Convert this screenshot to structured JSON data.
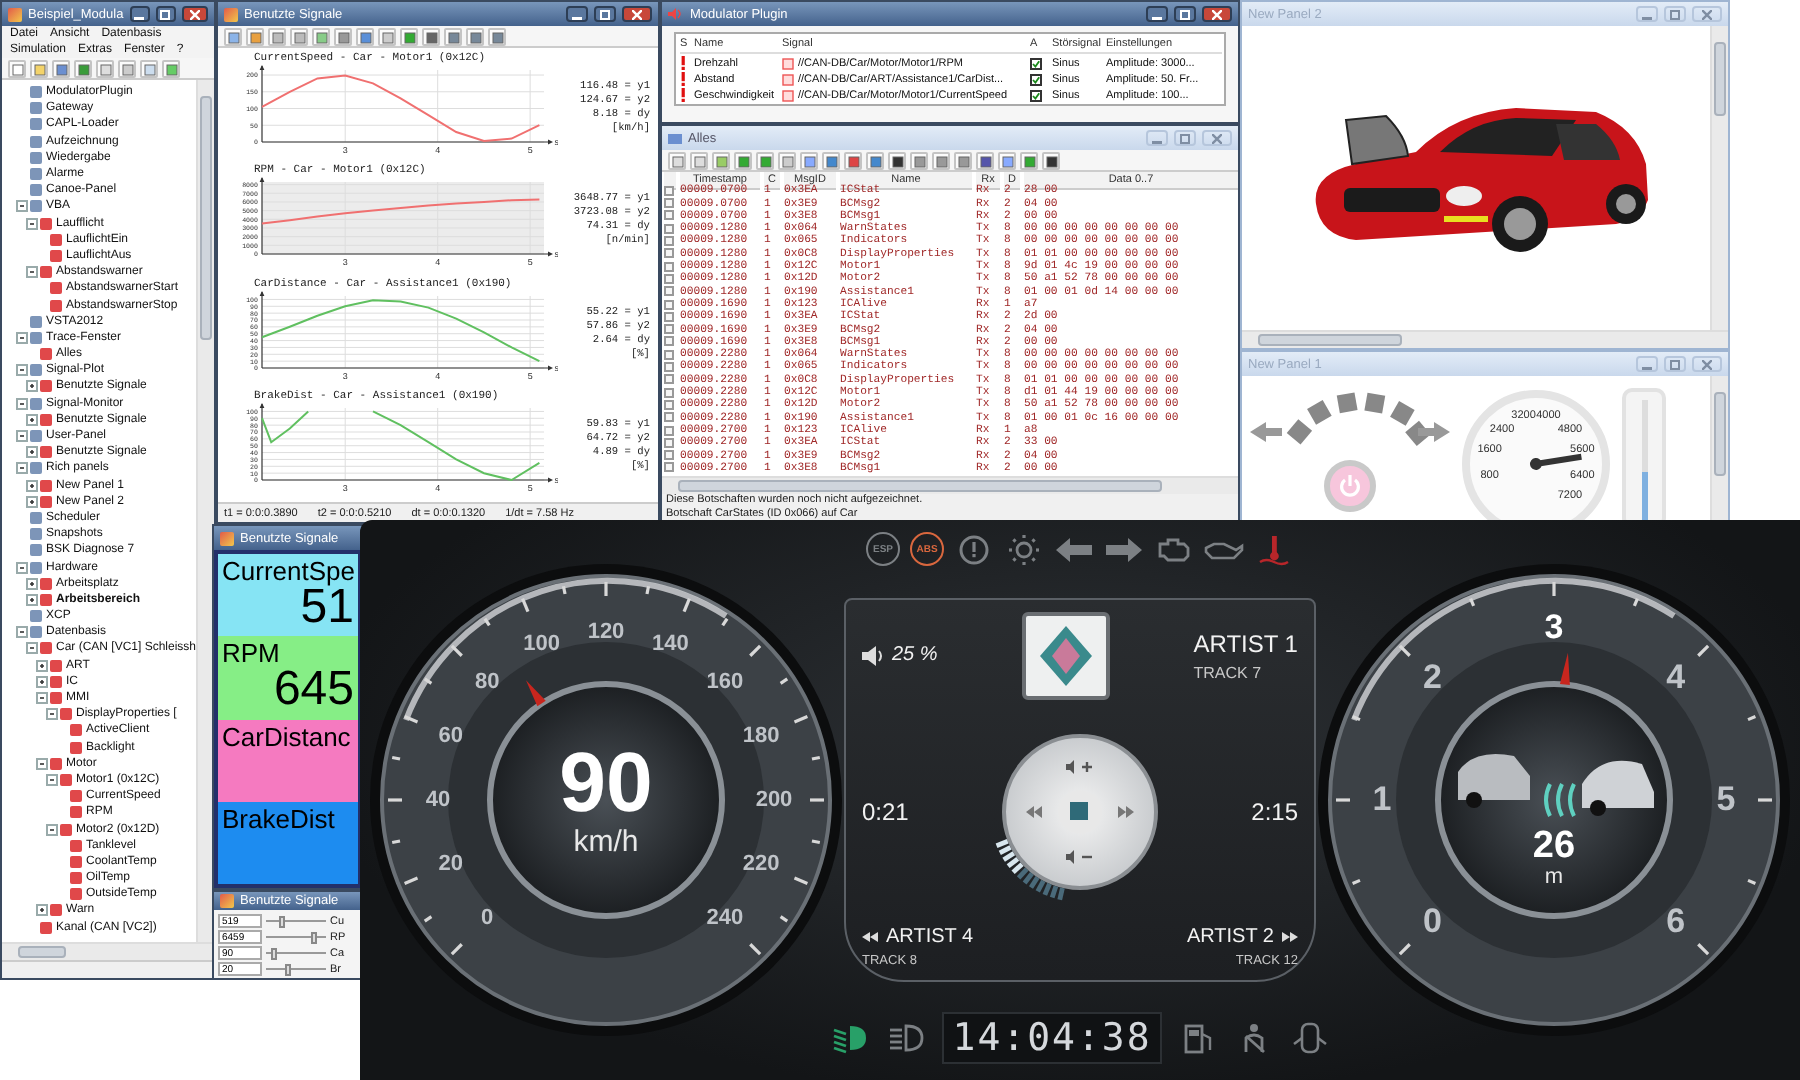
{
  "tree_window": {
    "title": "Beispiel_Modula",
    "menu": [
      [
        "Datei",
        "Ansicht",
        "Datenbasis"
      ],
      [
        "Simulation",
        "Extras",
        "Fenster",
        "?"
      ]
    ],
    "tree": [
      {
        "label": "ModulatorPlugin"
      },
      {
        "label": "Gateway"
      },
      {
        "label": "CAPL-Loader"
      },
      {
        "label": "Aufzeichnung"
      },
      {
        "label": "Wiedergabe"
      },
      {
        "label": "Alarme"
      },
      {
        "label": "Canoe-Panel"
      },
      {
        "label": "VBA",
        "expanded": true,
        "children": [
          {
            "label": "Laufflicht",
            "expanded": true,
            "children": [
              {
                "label": "LauflichtEin"
              },
              {
                "label": "LauflichtAus"
              }
            ]
          },
          {
            "label": "Abstandswarner",
            "expanded": true,
            "children": [
              {
                "label": "AbstandswarnerStart"
              },
              {
                "label": "AbstandswarnerStop"
              }
            ]
          }
        ]
      },
      {
        "label": "VSTA2012"
      },
      {
        "label": "Trace-Fenster",
        "expanded": true,
        "children": [
          {
            "label": "Alles"
          }
        ]
      },
      {
        "label": "Signal-Plot",
        "expanded": true,
        "children": [
          {
            "label": "Benutzte Signale",
            "expanded": false
          }
        ]
      },
      {
        "label": "Signal-Monitor",
        "expanded": true,
        "children": [
          {
            "label": "Benutzte Signale",
            "expanded": false
          }
        ]
      },
      {
        "label": "User-Panel",
        "expanded": true,
        "children": [
          {
            "label": "Benutzte Signale",
            "expanded": false
          }
        ]
      },
      {
        "label": "Rich panels",
        "expanded": true,
        "children": [
          {
            "label": "New Panel 1",
            "expanded": false
          },
          {
            "label": "New Panel 2",
            "expanded": false
          }
        ]
      },
      {
        "label": "Scheduler"
      },
      {
        "label": "Snapshots"
      },
      {
        "label": "BSK Diagnose 7"
      },
      {
        "label": "Hardware",
        "expanded": true,
        "children": [
          {
            "label": "Arbeitsplatz",
            "expanded": false
          },
          {
            "label": "Arbeitsbereich",
            "expanded": false,
            "bold": true
          }
        ]
      },
      {
        "label": "XCP"
      },
      {
        "label": "Datenbasis",
        "expanded": true,
        "children": [
          {
            "label": "Car (CAN [VC1] Schleissh",
            "expanded": true,
            "children": [
              {
                "label": "ART",
                "expanded": false
              },
              {
                "label": "IC",
                "expanded": false
              },
              {
                "label": "MMI",
                "expanded": true,
                "children": [
                  {
                    "label": "DisplayProperties [",
                    "expanded": true,
                    "children": [
                      {
                        "label": "ActiveClient"
                      },
                      {
                        "label": "Backlight"
                      }
                    ]
                  }
                ]
              },
              {
                "label": "Motor",
                "expanded": true,
                "children": [
                  {
                    "label": "Motor1 (0x12C)",
                    "expanded": true,
                    "children": [
                      {
                        "label": "CurrentSpeed"
                      },
                      {
                        "label": "RPM"
                      }
                    ]
                  },
                  {
                    "label": "Motor2 (0x12D)",
                    "expanded": true,
                    "children": [
                      {
                        "label": "Tanklevel"
                      },
                      {
                        "label": "CoolantTemp"
                      },
                      {
                        "label": "OilTemp"
                      },
                      {
                        "label": "OutsideTemp"
                      }
                    ]
                  }
                ]
              },
              {
                "label": "Warn",
                "expanded": false
              }
            ]
          },
          {
            "label": "Kanal (CAN [VC2])"
          }
        ]
      }
    ]
  },
  "signal_plot": {
    "title": "Benutzte Signale",
    "plots": [
      {
        "title": "CurrentSpeed - Car - Motor1 (0x12C)",
        "readouts": [
          "116.48 = y1",
          "124.67 = y2",
          "8.18 = dy",
          "[km/h]"
        ],
        "chart_data": {
          "type": "line",
          "xlabel": "s",
          "grid": true,
          "x": [
            2.1,
            2.4,
            2.7,
            3.0,
            3.3,
            3.6,
            3.9,
            4.2,
            4.5,
            4.8,
            5.1
          ],
          "series": [
            {
              "color": "#f07070",
              "values": [
                105,
                150,
                190,
                198,
                175,
                130,
                80,
                30,
                3,
                10,
                50
              ]
            }
          ],
          "xlim": [
            2.1,
            5.15
          ],
          "ylim": [
            0,
            215
          ],
          "xticks": [
            3,
            4,
            5
          ],
          "yticks": [
            0,
            50,
            100,
            150,
            200
          ]
        }
      },
      {
        "title": "RPM - Car - Motor1 (0x12C)",
        "readouts": [
          "3648.77 = y1",
          "3723.08 = y2",
          "74.31 = dy",
          "[n/min]"
        ],
        "chart_data": {
          "type": "line",
          "xlabel": "s",
          "grid": true,
          "x": [
            2.1,
            2.4,
            2.7,
            3.0,
            3.3,
            3.6,
            3.9,
            4.2,
            4.5,
            4.8,
            5.1
          ],
          "series": [
            {
              "color": "#f07070",
              "values": [
                3500,
                3900,
                4300,
                4700,
                5000,
                5300,
                5600,
                5800,
                6000,
                6200,
                6300
              ]
            }
          ],
          "xlim": [
            2.1,
            5.15
          ],
          "ylim": [
            0,
            8300
          ],
          "xticks": [
            3,
            4,
            5
          ],
          "yticks": [
            0,
            1000,
            2000,
            3000,
            4000,
            5000,
            6000,
            7000,
            8000
          ]
        }
      },
      {
        "title": "CarDistance - Car - Assistance1 (0x190)",
        "readouts": [
          "55.22 = y1",
          "57.86 = y2",
          "2.64 = dy",
          "[%]"
        ],
        "chart_data": {
          "type": "line",
          "xlabel": "s",
          "grid": true,
          "x": [
            2.1,
            2.4,
            2.7,
            3.0,
            3.3,
            3.6,
            3.9,
            4.2,
            4.5,
            4.8,
            5.1
          ],
          "series": [
            {
              "color": "#60c060",
              "values": [
                45,
                60,
                76,
                90,
                99,
                97,
                88,
                72,
                52,
                30,
                10
              ]
            }
          ],
          "xlim": [
            2.1,
            5.15
          ],
          "ylim": [
            0,
            105
          ],
          "xticks": [
            3,
            4,
            5
          ],
          "yticks": [
            0,
            10,
            20,
            30,
            40,
            50,
            60,
            70,
            80,
            90,
            100
          ]
        }
      },
      {
        "title": "BrakeDist - Car - Assistance1 (0x190)",
        "readouts": [
          "59.83 = y1",
          "64.72 = y2",
          "4.89 = dy",
          "[%]"
        ],
        "chart_data": {
          "type": "line",
          "xlabel": "s",
          "grid": true,
          "x": [
            2.1,
            2.2,
            2.4,
            2.6,
            2.9,
            3.3,
            3.6,
            3.9,
            4.2,
            4.5,
            4.8,
            5.1
          ],
          "series": [
            {
              "color": "#60c060",
              "values": [
                90,
                55,
                75,
                100,
                null,
                100,
                80,
                55,
                30,
                10,
                0,
                25
              ]
            }
          ],
          "xlim": [
            2.1,
            5.15
          ],
          "ylim": [
            0,
            105
          ],
          "xticks": [
            3,
            4,
            5
          ],
          "yticks": [
            0,
            10,
            20,
            30,
            40,
            50,
            60,
            70,
            80,
            90,
            100
          ]
        }
      }
    ],
    "status": [
      "t1 = 0:0:0.3890",
      "t2 = 0:0:0.5210",
      "dt = 0:0:0.1320",
      "1/dt = 7.58 Hz"
    ]
  },
  "modulator": {
    "title": "Modulator Plugin",
    "columns": [
      "S",
      "Name",
      "Signal",
      "A",
      "Störsignal",
      "Einstellungen"
    ],
    "rows": [
      {
        "name": "Drehzahl",
        "signal": "//CAN-DB/Car/Motor/Motor1/RPM",
        "active": true,
        "noise": "Sinus",
        "settings": "Amplitude: 3000..."
      },
      {
        "name": "Abstand",
        "signal": "//CAN-DB/Car/ART/Assistance1/CarDist...",
        "active": true,
        "noise": "Sinus",
        "settings": "Amplitude: 50. Fr..."
      },
      {
        "name": "Geschwindigkeit",
        "signal": "//CAN-DB/Car/Motor/Motor1/CurrentSpeed",
        "active": true,
        "noise": "Sinus",
        "settings": "Amplitude: 100..."
      }
    ]
  },
  "trace": {
    "title": "Alles",
    "columns": [
      "Timestamp",
      "C",
      "MsgID",
      "Name",
      "Rx",
      "D",
      "Data 0..7"
    ],
    "rows": [
      [
        "00009.0700",
        "1",
        "0x3EA",
        "ICStat",
        "Rx",
        "2",
        "28 00"
      ],
      [
        "00009.0700",
        "1",
        "0x3E9",
        "BCMsg2",
        "Rx",
        "2",
        "04 00"
      ],
      [
        "00009.0700",
        "1",
        "0x3E8",
        "BCMsg1",
        "Rx",
        "2",
        "00 00"
      ],
      [
        "00009.1280",
        "1",
        "0x064",
        "WarnStates",
        "Tx",
        "8",
        "00 00 00 00 00 00 00 00"
      ],
      [
        "00009.1280",
        "1",
        "0x065",
        "Indicators",
        "Tx",
        "8",
        "00 00 00 00 00 00 00 00"
      ],
      [
        "00009.1280",
        "1",
        "0x0C8",
        "DisplayProperties",
        "Tx",
        "8",
        "01 01 00 00 00 00 00 00"
      ],
      [
        "00009.1280",
        "1",
        "0x12C",
        "Motor1",
        "Tx",
        "8",
        "9d 01 4c 19 00 00 00 00"
      ],
      [
        "00009.1280",
        "1",
        "0x12D",
        "Motor2",
        "Tx",
        "8",
        "50 a1 52 78 00 00 00 00"
      ],
      [
        "00009.1280",
        "1",
        "0x190",
        "Assistance1",
        "Tx",
        "8",
        "01 00 01 0d 14 00 00 00"
      ],
      [
        "00009.1690",
        "1",
        "0x123",
        "ICAlive",
        "Rx",
        "1",
        "a7"
      ],
      [
        "00009.1690",
        "1",
        "0x3EA",
        "ICStat",
        "Rx",
        "2",
        "2d 00"
      ],
      [
        "00009.1690",
        "1",
        "0x3E9",
        "BCMsg2",
        "Rx",
        "2",
        "04 00"
      ],
      [
        "00009.1690",
        "1",
        "0x3E8",
        "BCMsg1",
        "Rx",
        "2",
        "00 00"
      ],
      [
        "00009.2280",
        "1",
        "0x064",
        "WarnStates",
        "Tx",
        "8",
        "00 00 00 00 00 00 00 00"
      ],
      [
        "00009.2280",
        "1",
        "0x065",
        "Indicators",
        "Tx",
        "8",
        "00 00 00 00 00 00 00 00"
      ],
      [
        "00009.2280",
        "1",
        "0x0C8",
        "DisplayProperties",
        "Tx",
        "8",
        "01 01 00 00 00 00 00 00"
      ],
      [
        "00009.2280",
        "1",
        "0x12C",
        "Motor1",
        "Tx",
        "8",
        "d1 01 44 19 00 00 00 00"
      ],
      [
        "00009.2280",
        "1",
        "0x12D",
        "Motor2",
        "Tx",
        "8",
        "50 a1 52 78 00 00 00 00"
      ],
      [
        "00009.2280",
        "1",
        "0x190",
        "Assistance1",
        "Tx",
        "8",
        "01 00 01 0c 16 00 00 00"
      ],
      [
        "00009.2700",
        "1",
        "0x123",
        "ICAlive",
        "Rx",
        "1",
        "a8"
      ],
      [
        "00009.2700",
        "1",
        "0x3EA",
        "ICStat",
        "Rx",
        "2",
        "33 00"
      ],
      [
        "00009.2700",
        "1",
        "0x3E9",
        "BCMsg2",
        "Rx",
        "2",
        "04 00"
      ],
      [
        "00009.2700",
        "1",
        "0x3E8",
        "BCMsg1",
        "Rx",
        "2",
        "00 00"
      ]
    ],
    "status": [
      "Diese Botschaften wurden noch nicht aufgezeichnet.",
      "Botschaft CarStates (ID 0x066) auf Car"
    ]
  },
  "panel_car": {
    "title": "New Panel 2"
  },
  "panel_controls": {
    "title": "New Panel 1",
    "gauge": {
      "labels": [
        "800",
        "1600",
        "2400",
        "3200",
        "4000",
        "4800",
        "5600",
        "6400",
        "7200"
      ],
      "level": 0.8
    },
    "thermometer": {
      "level": 0.55
    }
  },
  "signal_display": {
    "title": "Benutzte Signale",
    "signals": [
      {
        "name": "CurrentSpe",
        "value": "51",
        "color": "#86e4f4"
      },
      {
        "name": "RPM",
        "value": "645",
        "color": "#86ee86"
      },
      {
        "name": "CarDistanc",
        "color": "#f57ac0"
      },
      {
        "name": "BrakeDist",
        "color": "#1d8cf0"
      }
    ]
  },
  "signal_sliders": {
    "title": "Benutzte Signale",
    "rows": [
      {
        "value": "519",
        "level": 0.25,
        "label": "Cu"
      },
      {
        "value": "6459",
        "level": 0.8,
        "label": "RP"
      },
      {
        "value": "90",
        "level": 0.12,
        "label": "Ca"
      },
      {
        "value": "20",
        "level": 0.35,
        "label": "Br"
      }
    ]
  },
  "dashboard": {
    "top_indicators": [
      {
        "kind": "esp",
        "label": "ESP",
        "active": false
      },
      {
        "kind": "abs",
        "label": "ABS",
        "active": true
      },
      {
        "kind": "brake-warning",
        "active": false
      },
      {
        "kind": "glow-plug",
        "active": false
      },
      {
        "kind": "turn-left",
        "active": false
      },
      {
        "kind": "turn-right",
        "active": false
      },
      {
        "kind": "engine",
        "active": false
      },
      {
        "kind": "oil",
        "active": false
      },
      {
        "kind": "coolant",
        "active": true
      }
    ],
    "speedometer": {
      "ticks": [
        "0",
        "20",
        "40",
        "60",
        "80",
        "100",
        "120",
        "140",
        "160",
        "180",
        "200",
        "220",
        "240"
      ],
      "value": "90",
      "unit": "km/h",
      "level": 0.375
    },
    "media": {
      "volume": "25 %",
      "artist": "ARTIST 1",
      "track": "TRACK 7",
      "elapsed": "0:21",
      "remaining": "2:15",
      "previous": {
        "artist": "ARTIST 4",
        "track": "TRACK 8"
      },
      "next": {
        "artist": "ARTIST 2",
        "track": "TRACK 12"
      },
      "progress": {
        "level": 0.4
      }
    },
    "distance_gauge": {
      "ticks": [
        "0",
        "1",
        "2",
        "3",
        "4",
        "5",
        "6"
      ],
      "value": "26",
      "unit": "m",
      "level": 0.52
    },
    "bottom_left": [
      {
        "kind": "low-beam",
        "active": true
      },
      {
        "kind": "high-beam",
        "active": false
      }
    ],
    "clock": "14:04:38",
    "bottom_right": [
      {
        "kind": "fuel",
        "active": false
      },
      {
        "kind": "seatbelt",
        "active": false
      },
      {
        "kind": "door",
        "active": false
      }
    ]
  }
}
